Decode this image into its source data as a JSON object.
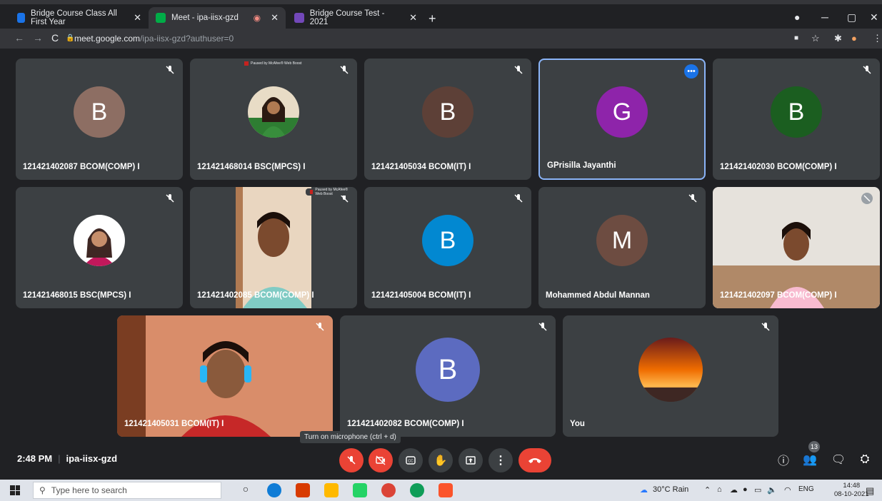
{
  "browser": {
    "tabs": [
      {
        "title": "Bridge Course Class All First Year",
        "active": false,
        "color": "#1a73e8"
      },
      {
        "title": "Meet - ipa-iisx-gzd",
        "active": true,
        "color": "#00ac47"
      },
      {
        "title": "Bridge Course Test - 2021",
        "active": false,
        "color": "#7248b9"
      }
    ],
    "url_host": "meet.google.com",
    "url_path": "/ipa-iisx-gzd?authuser=0"
  },
  "tiles": [
    {
      "name": "121421402087 BCOM(COMP) I",
      "initial": "B",
      "color": "#8d6e63",
      "type": "letter"
    },
    {
      "name": "121421468014 BSC(MPCS) I",
      "type": "photo",
      "photo": "green"
    },
    {
      "name": "121421405034 BCOM(IT) I",
      "initial": "B",
      "color": "#5d4037",
      "type": "letter"
    },
    {
      "name": "GPrisilla Jayanthi",
      "initial": "G",
      "color": "#8e24aa",
      "type": "letter",
      "selected": true
    },
    {
      "name": "121421402030 BCOM(COMP) I",
      "initial": "B",
      "color": "#1b5e20",
      "type": "letter"
    },
    {
      "name": "121421468015 BSC(MPCS) I",
      "type": "photo",
      "photo": "pink"
    },
    {
      "name": "121421402085 BCOM(COMP) I",
      "type": "video",
      "photo": "man"
    },
    {
      "name": "121421405004 BCOM(IT) I",
      "initial": "B",
      "color": "#0288d1",
      "type": "letter"
    },
    {
      "name": "Mohammed Abdul Mannan",
      "initial": "M",
      "color": "#6d4c41",
      "type": "letter"
    },
    {
      "name": "121421402097 BCOM(COMP) I",
      "type": "video",
      "photo": "woman"
    },
    {
      "name": "121421405031 BCOM(IT) I",
      "type": "video",
      "photo": "headphones"
    },
    {
      "name": "121421402082 BCOM(COMP) I",
      "initial": "B",
      "color": "#5c6bc0",
      "type": "letter"
    },
    {
      "name": "You",
      "type": "photo",
      "photo": "sunset"
    }
  ],
  "badge": {
    "text": "Paused by McAfee® Web Boost"
  },
  "bottom": {
    "time": "2:48 PM",
    "meeting_code": "ipa-iisx-gzd",
    "tooltip": "Turn on microphone (ctrl + d)",
    "participant_count": "13"
  },
  "taskbar": {
    "search_placeholder": "Type here to search",
    "weather": "30°C  Rain",
    "lang": "ENG",
    "clock_time": "14:48",
    "clock_date": "08-10-2021"
  }
}
